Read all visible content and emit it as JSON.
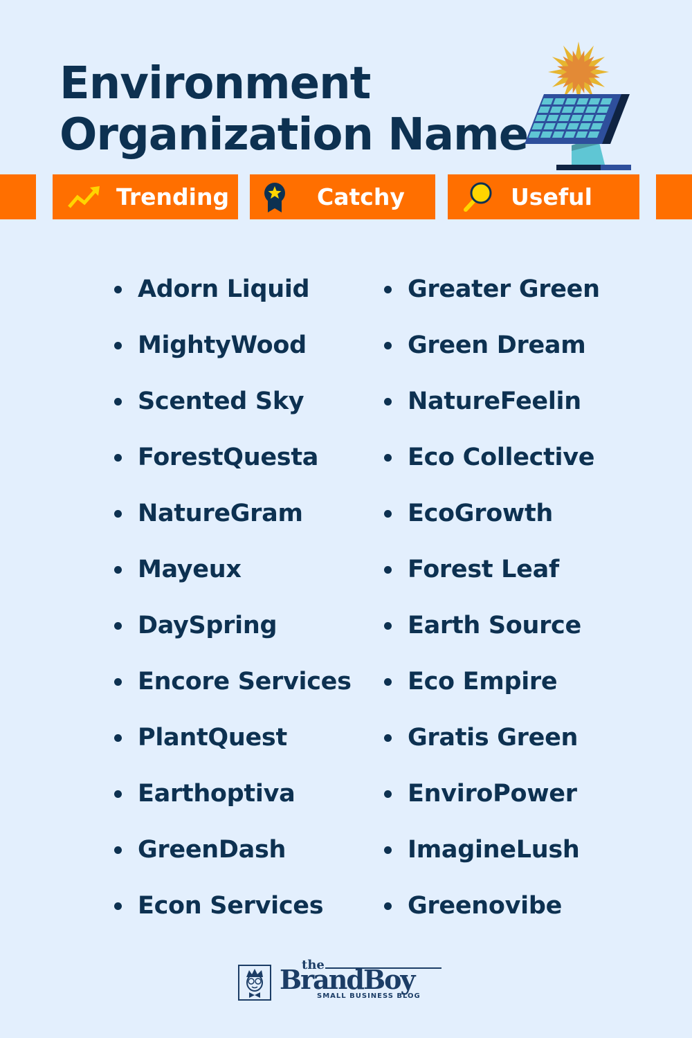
{
  "header": {
    "title_line1": "Environment",
    "title_line2": "Organization Name",
    "illustration": "solar-panel-with-sun"
  },
  "tabs": [
    {
      "label": "Trending",
      "icon": "trending-up-arrow-icon"
    },
    {
      "label": "Catchy",
      "icon": "award-ribbon-star-icon"
    },
    {
      "label": "Useful",
      "icon": "magnifier-icon"
    }
  ],
  "names": {
    "left": [
      "Adorn Liquid",
      "MightyWood",
      "Scented Sky",
      "ForestQuesta",
      "NatureGram",
      "Mayeux",
      "DaySpring",
      "Encore Services",
      "PlantQuest",
      "Earthoptiva",
      "GreenDash",
      "Econ Services"
    ],
    "right": [
      "Greater Green",
      "Green Dream",
      "NatureFeelin",
      "Eco Collective",
      "EcoGrowth",
      "Forest Leaf",
      "Earth Source",
      "Eco Empire",
      "Gratis Green",
      "EnviroPower",
      "ImagineLush",
      "Greenovibe"
    ]
  },
  "footer": {
    "logo_the": "the",
    "logo_brand": "BrandBoy",
    "logo_tagline": "SMALL BUSINESS BLOG"
  },
  "colors": {
    "background": "#e3effd",
    "primary_text": "#0d3151",
    "accent_orange": "#ff6f00",
    "icon_yellow": "#ffd500",
    "tab_text": "#ffffff"
  }
}
